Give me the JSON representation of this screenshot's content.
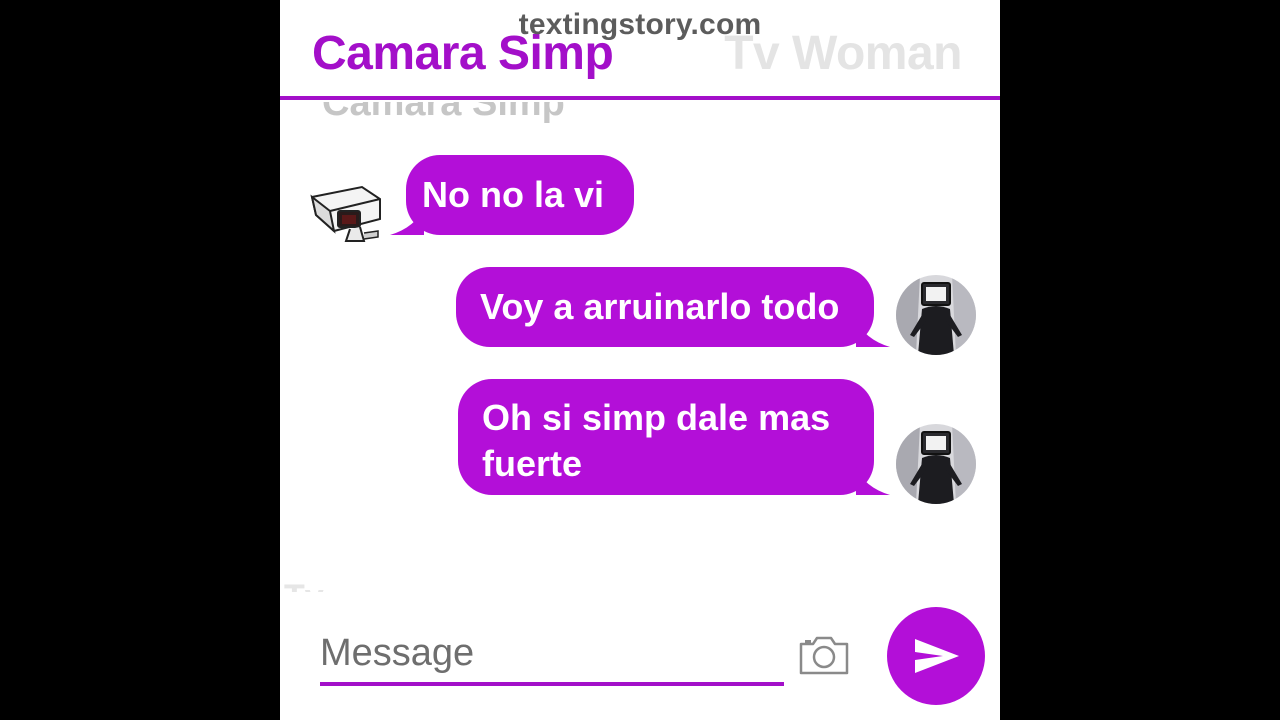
{
  "watermark": "textingstory.com",
  "header": {
    "active_name": "Camara Simp",
    "other_name": "Tv Woman"
  },
  "ghost": {
    "previous_name": "Camara Simp"
  },
  "messages": [
    {
      "sender": "Camara Simp",
      "side": "left",
      "text": "No no la vi",
      "avatar": "security-camera-icon"
    },
    {
      "sender": "Tv Woman",
      "side": "right",
      "text": "Voy a arruinarlo todo",
      "avatar": "tv-woman-avatar"
    },
    {
      "sender": "Tv Woman",
      "side": "right",
      "text": "Oh si simp dale mas fuerte",
      "avatar": "tv-woman-avatar"
    }
  ],
  "input": {
    "placeholder": "Message"
  },
  "icons": {
    "camera": "camera-icon",
    "send": "send-icon"
  },
  "colors": {
    "accent": "#a30fc9",
    "bubble": "#b30fd8",
    "background": "#ffffff",
    "letterbox": "#000000"
  }
}
